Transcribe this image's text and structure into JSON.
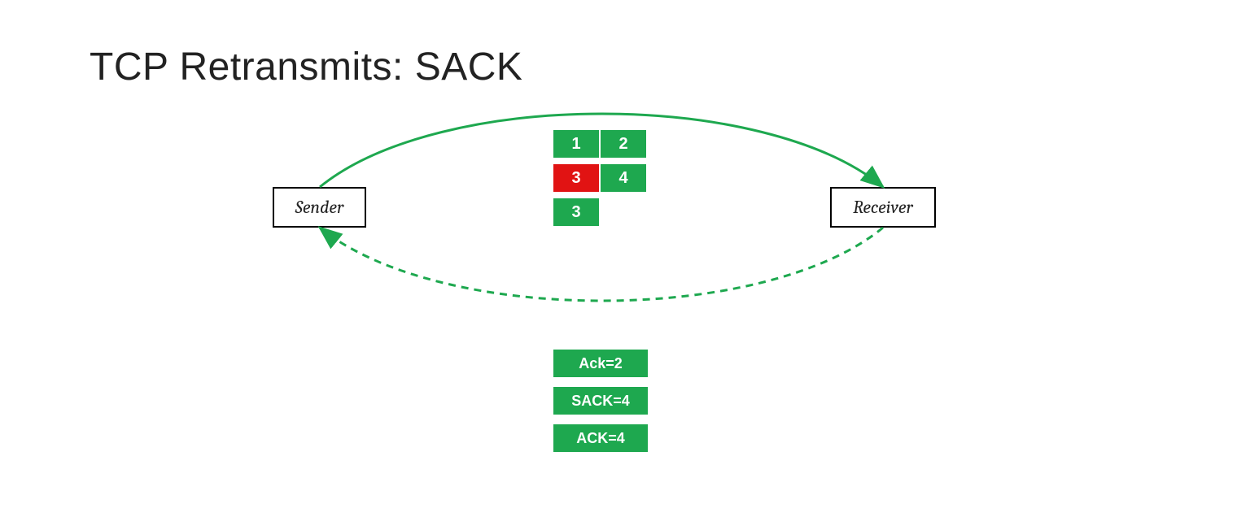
{
  "title": "TCP Retransmits: SACK",
  "nodes": {
    "sender": "Sender",
    "receiver": "Receiver"
  },
  "packets_forward": {
    "row1": {
      "a": "1",
      "b": "2"
    },
    "row2": {
      "a": "3",
      "b": "4"
    },
    "row3": {
      "a": "3"
    }
  },
  "acks_back": {
    "a": "Ack=2",
    "b": "SACK=4",
    "c": "ACK=4"
  },
  "colors": {
    "green": "#1ea84f",
    "red": "#e11313",
    "arrow": "#1ea84f"
  }
}
